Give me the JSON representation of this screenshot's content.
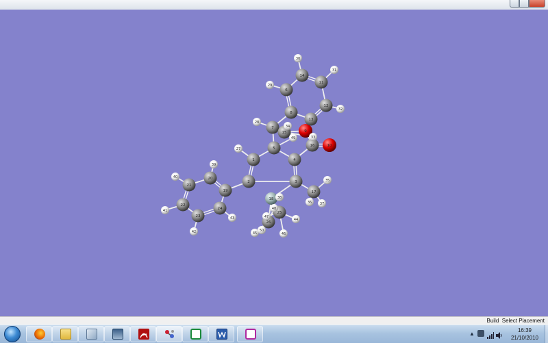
{
  "status": {
    "build_label": "Build",
    "placement_label": "Select Placement"
  },
  "clock": {
    "time": "16:39",
    "date": "21/10/2010"
  },
  "taskbar": {
    "apps": [
      "firefox-icon",
      "explorer-folder-icon",
      "notepad-icon",
      "media-icon",
      "acrobat-icon",
      "gaussview-icon",
      "chemdraw-icon",
      "word-icon",
      "chem3d-icon"
    ]
  },
  "molecule": {
    "atoms": [
      "1",
      "2",
      "3",
      "4",
      "5",
      "6",
      "7",
      "8",
      "9",
      "10",
      "11",
      "12",
      "13",
      "14",
      "15",
      "16",
      "17",
      "18",
      "19",
      "20",
      "21",
      "22",
      "23",
      "24",
      "25",
      "26",
      "27",
      "28",
      "29",
      "30",
      "31",
      "32",
      "33",
      "34",
      "35",
      "36",
      "37",
      "38",
      "39",
      "40",
      "41",
      "42",
      "43",
      "44",
      "45",
      "46",
      "47",
      "48",
      "49",
      "50"
    ]
  },
  "colors": {
    "background": "#8482cc",
    "carbon": "#8c8c8c",
    "hydrogen": "#f2f2f2",
    "oxygen": "#dd0000",
    "silicon": "#9fb4b4"
  }
}
